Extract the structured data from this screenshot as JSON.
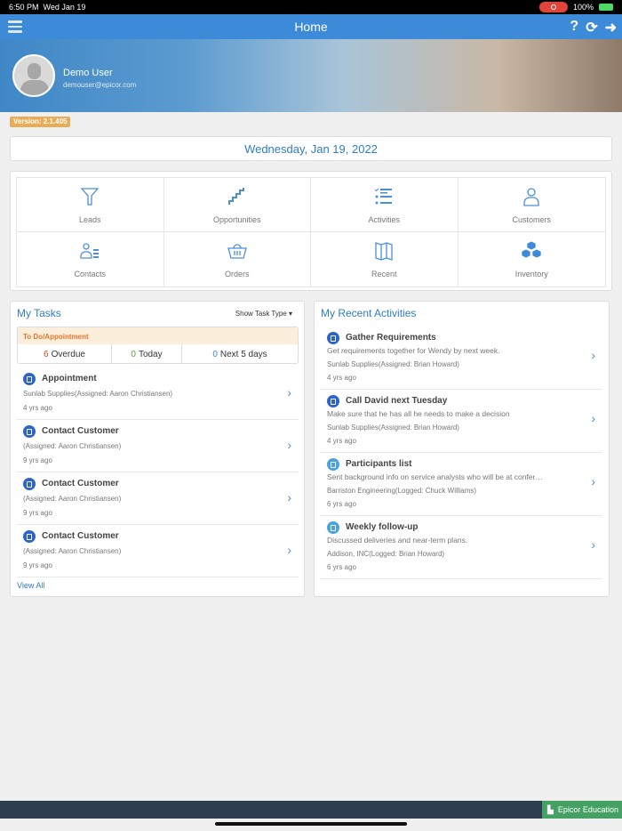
{
  "status": {
    "time": "6:50 PM",
    "date": "Wed Jan 19",
    "battery": "100%"
  },
  "nav": {
    "title": "Home"
  },
  "user": {
    "name": "Demo User",
    "email": "demouser@epicor.com"
  },
  "version": "Version: 2.1.405",
  "date": "Wednesday, Jan 19, 2022",
  "tiles": [
    {
      "label": "Leads",
      "icon": "funnel-icon"
    },
    {
      "label": "Opportunities",
      "icon": "stairs-icon"
    },
    {
      "label": "Activities",
      "icon": "checklist-icon"
    },
    {
      "label": "Customers",
      "icon": "person-icon"
    },
    {
      "label": "Contacts",
      "icon": "contact-list-icon"
    },
    {
      "label": "Orders",
      "icon": "basket-icon"
    },
    {
      "label": "Recent",
      "icon": "map-icon"
    },
    {
      "label": "Inventory",
      "icon": "boxes-icon"
    }
  ],
  "tasks": {
    "title": "My Tasks",
    "type_label": "Show Task Type",
    "header": "To Do/Appointment",
    "overdue": {
      "n": "6",
      "label": "Overdue"
    },
    "today": {
      "n": "0",
      "label": "Today"
    },
    "next": {
      "n": "0",
      "label": "Next 5 days"
    },
    "items": [
      {
        "title": "Appointment",
        "line": "Sunlab Supplies(Assigned: Aaron Christiansen)",
        "age": "4 yrs ago"
      },
      {
        "title": "Contact Customer",
        "line": "(Assigned: Aaron Christiansen)",
        "age": "9 yrs ago"
      },
      {
        "title": "Contact Customer",
        "line": "(Assigned: Aaron Christiansen)",
        "age": "9 yrs ago"
      },
      {
        "title": "Contact Customer",
        "line": "(Assigned: Aaron Christiansen)",
        "age": "9 yrs ago"
      }
    ],
    "view_all": "View All"
  },
  "activities": {
    "title": "My Recent Activities",
    "items": [
      {
        "title": "Gather Requirements",
        "desc": "Get requirements together for Wendy by next week.",
        "line": "Sunlab Supplies(Assigned: Brian Howard)",
        "age": "4 yrs ago"
      },
      {
        "title": "Call David next Tuesday",
        "desc": "Make sure that he has all he needs to make a decision",
        "line": "Sunlab Supplies(Assigned: Brian Howard)",
        "age": "4 yrs ago"
      },
      {
        "title": "Participants list",
        "desc": "Sent background info on service analysts who will be at confer…",
        "line": "Barriston Engineering(Logged: Chuck Williams)",
        "age": "6 yrs ago"
      },
      {
        "title": "Weekly follow-up",
        "desc": "Discussed deliveries and near-term plans.",
        "line": "Addison, INC(Logged: Brian Howard)",
        "age": "6 yrs ago"
      }
    ]
  },
  "footer": {
    "brand": "Epicor Education"
  }
}
